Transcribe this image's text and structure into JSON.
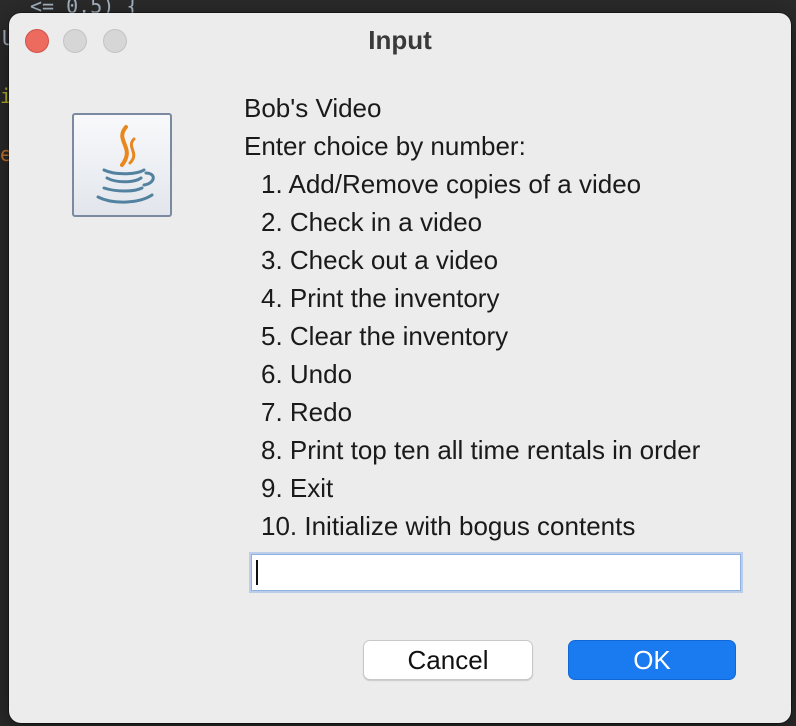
{
  "window": {
    "title": "Input",
    "buttons": [
      "close",
      "minimize",
      "maximize"
    ]
  },
  "background": {
    "code_fragments": [
      "U",
      "<= 0.5) {",
      "i",
      "e"
    ]
  },
  "icon": {
    "name": "java-icon"
  },
  "message": {
    "heading": "Bob's Video",
    "prompt": "Enter choice by number:",
    "options": [
      "1. Add/Remove copies of a video",
      "2. Check in a video",
      "3. Check out a video",
      "4. Print the inventory",
      "5. Clear the inventory",
      "6. Undo",
      "7. Redo",
      "8. Print top ten all time rentals in order",
      "9. Exit",
      "10. Initialize with bogus contents"
    ]
  },
  "input": {
    "value": ""
  },
  "buttons": {
    "cancel": "Cancel",
    "ok": "OK"
  },
  "colors": {
    "ok_button": "#1a7af0",
    "close_light": "#ec6a5e",
    "input_focus": "#8fb3e0"
  }
}
